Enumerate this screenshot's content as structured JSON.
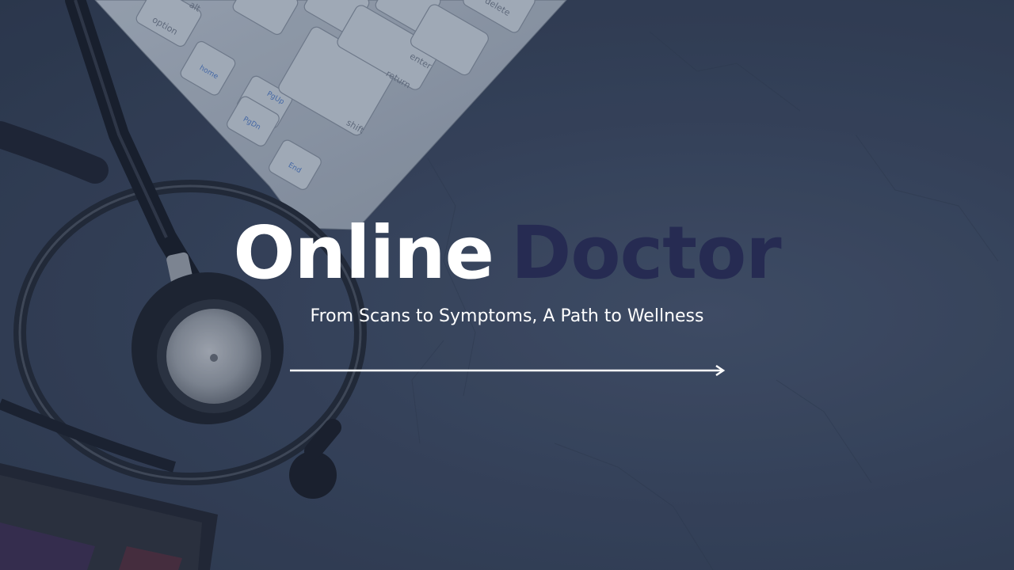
{
  "slide": {
    "title_part_1": "Online",
    "title_part_2": "Doctor",
    "subtitle": "From Scans to Symptoms, A Path to Wellness"
  },
  "keyboard": {
    "keys": {
      "option": "option",
      "alt": "alt",
      "home": "home",
      "pgup": "PgUp",
      "pgdn": "PgDn",
      "end": "End",
      "shift": "shift",
      "return": "return",
      "enter": "enter",
      "delete": "delete"
    }
  },
  "colors": {
    "background": "#36435a",
    "title_primary": "#ffffff",
    "title_accent": "#262b52",
    "subtitle": "#ffffff",
    "arrow": "#ffffff"
  },
  "icons": {
    "arrow": "right-arrow-icon",
    "stethoscope": "stethoscope-icon"
  }
}
